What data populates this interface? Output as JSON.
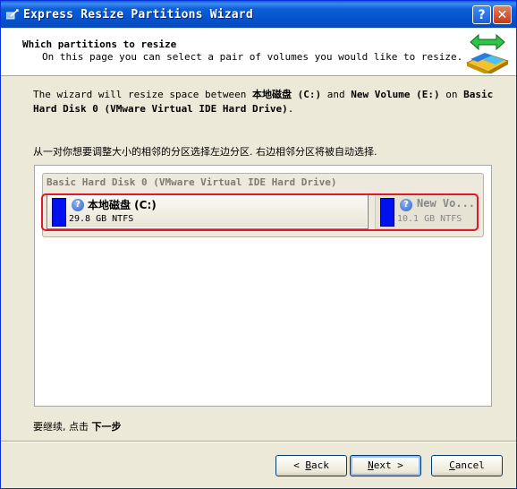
{
  "window": {
    "title": "Express Resize Partitions Wizard",
    "help_label": "?",
    "close_label": "✕"
  },
  "header": {
    "title": "Which partitions to resize",
    "subtitle": "On this page you can select a pair of volumes you would like to resize."
  },
  "description": {
    "part1": "The wizard will resize space between ",
    "left_name": "本地磁盘 (C:)",
    "part2": " and ",
    "right_name": "New Volume (E:)",
    "part3": " on ",
    "disk_name": "Basic Hard Disk 0 (VMware Virtual IDE Hard Drive)",
    "part4": "."
  },
  "instruction": "从一对你想要调整大小的相邻的分区选择左边分区. 右边相邻分区将被自动选择.",
  "disk": {
    "label": "Basic Hard Disk 0 (VMware Virtual IDE Hard Drive)",
    "partitions": [
      {
        "name": "本地磁盘 (C:)",
        "size": "29.8 GB NTFS",
        "selected": true
      },
      {
        "name": "New Vo...",
        "size": "10.1 GB NTFS",
        "selected": false
      }
    ]
  },
  "continue_text": {
    "prefix": "要继续, 点击 ",
    "action": "下一步"
  },
  "buttons": {
    "back_pre": "< ",
    "back_key": "B",
    "back_rest": "ack",
    "next_key": "N",
    "next_rest": "ext >",
    "cancel_pre": "",
    "cancel_key": "C",
    "cancel_rest": "ancel"
  },
  "colors": {
    "titlebar": "#0a5fd8",
    "partition_fill": "#0010f0",
    "selection_border": "#e0182a",
    "dialog_bg": "#ece9d8"
  }
}
